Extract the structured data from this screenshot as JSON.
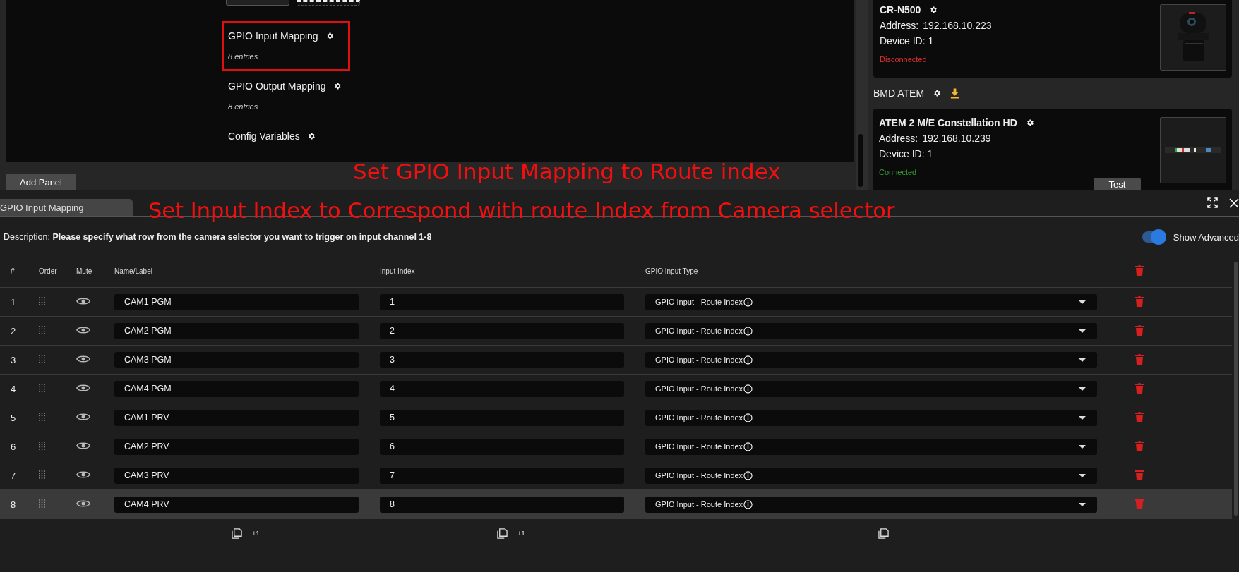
{
  "config_panel": {
    "items": [
      {
        "title": "GPIO Input Mapping",
        "subtitle": "8 entries",
        "highlighted": true
      },
      {
        "title": "GPIO Output Mapping",
        "subtitle": "8 entries",
        "highlighted": false
      },
      {
        "title": "Config Variables",
        "highlighted": false
      }
    ],
    "add_button": "Add Panel"
  },
  "devices": [
    {
      "kind": "card",
      "title": "CR-N500",
      "address_label": "Address:",
      "address": "192.168.10.223",
      "device_id": "Device ID: 1",
      "status": "Disconnected",
      "connected": false
    },
    {
      "kind": "group_header",
      "label": "BMD ATEM"
    },
    {
      "kind": "card",
      "title": "ATEM 2 M/E Constellation HD",
      "address_label": "Address:",
      "address": "192.168.10.239",
      "device_id": "Device ID: 1",
      "status": "Connected",
      "connected": true,
      "test_button": "Test"
    }
  ],
  "mapping_panel": {
    "tab": {
      "label": "GPIO Input Mapping",
      "selected": true
    },
    "description_label": "Description:",
    "description": "Please specify what row from the camera selector you want to trigger on input channel 1-8",
    "show_advanced": {
      "label": "Show Advanced",
      "on": true
    },
    "columns": [
      "#",
      "Order",
      "Mute",
      "Name/Label",
      "Input Index",
      "GPIO Input Type"
    ],
    "rows": [
      {
        "number": "1",
        "name": "CAM1 PGM",
        "input_index": "1",
        "type": "GPIO Input - Route Index",
        "selected": false
      },
      {
        "number": "2",
        "name": "CAM2 PGM",
        "input_index": "2",
        "type": "GPIO Input - Route Index",
        "selected": false
      },
      {
        "number": "3",
        "name": "CAM3 PGM",
        "input_index": "3",
        "type": "GPIO Input - Route Index",
        "selected": false
      },
      {
        "number": "4",
        "name": "CAM4 PGM",
        "input_index": "4",
        "type": "GPIO Input - Route Index",
        "selected": false
      },
      {
        "number": "5",
        "name": "CAM1 PRV",
        "input_index": "5",
        "type": "GPIO Input - Route Index",
        "selected": false
      },
      {
        "number": "6",
        "name": "CAM2 PRV",
        "input_index": "6",
        "type": "GPIO Input - Route Index",
        "selected": false
      },
      {
        "number": "7",
        "name": "CAM3 PRV",
        "input_index": "7",
        "type": "GPIO Input - Route Index",
        "selected": false
      },
      {
        "number": "8",
        "name": "CAM4 PRV",
        "input_index": "8",
        "type": "GPIO Input - Route Index",
        "selected": true
      }
    ],
    "footer_actions": [
      {
        "kind": "copy_plus",
        "label": "+1"
      },
      {
        "kind": "copy_plus",
        "label": "+1"
      },
      {
        "kind": "copy"
      }
    ]
  },
  "annotations": [
    {
      "text": "Set GPIO Input Mapping to Route index"
    },
    {
      "text": "Set Input Index to Correspond with route Index from Camera selector"
    }
  ]
}
